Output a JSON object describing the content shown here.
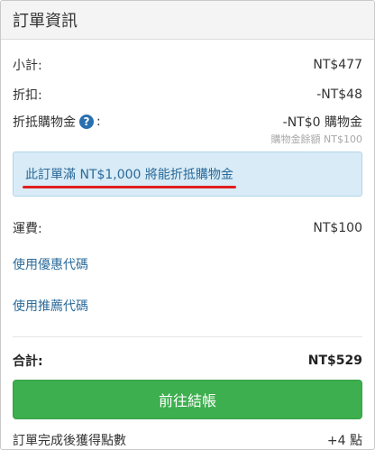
{
  "header": {
    "title": "訂單資訊"
  },
  "summary": {
    "subtotal_label": "小計:",
    "subtotal_value": "NT$477",
    "discount_label": "折扣:",
    "discount_value": "-NT$48",
    "credit_label": "折抵購物金",
    "credit_colon": ":",
    "credit_value": "-NT$0 購物金",
    "credit_balance": "購物金餘額 NT$100",
    "help_icon_glyph": "?"
  },
  "notice": {
    "text": "此訂單滿 NT$1,000 將能折抵購物金"
  },
  "shipping": {
    "label": "運費:",
    "value": "NT$100"
  },
  "links": {
    "coupon": "使用優惠代碼",
    "referral": "使用推薦代碼"
  },
  "total": {
    "label": "合計:",
    "value": "NT$529"
  },
  "checkout": {
    "button_label": "前往結帳"
  },
  "points": {
    "label": "訂單完成後獲得點數",
    "value": "+4 點"
  },
  "colors": {
    "primary_button": "#3daf4e",
    "link": "#2b6a9a",
    "notice_bg": "#d8ebf6",
    "help_icon": "#2a6fb0",
    "highlight_underline": "#e02020"
  }
}
